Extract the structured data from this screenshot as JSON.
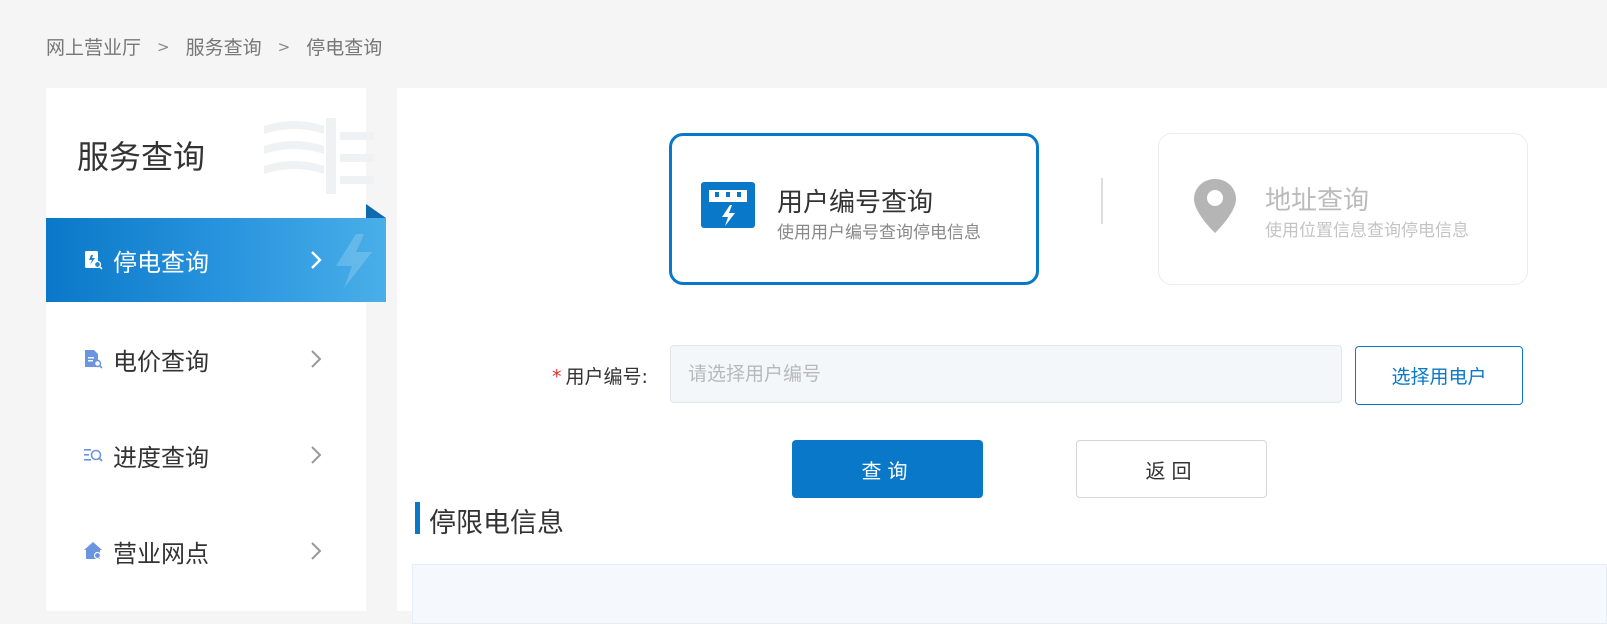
{
  "breadcrumb": {
    "items": [
      "网上营业厅",
      "服务查询",
      "停电查询"
    ],
    "separator": ">"
  },
  "sidebar": {
    "title": "服务查询",
    "items": [
      {
        "label": "停电查询",
        "icon": "outage-search-icon",
        "active": true
      },
      {
        "label": "电价查询",
        "icon": "price-search-icon",
        "active": false
      },
      {
        "label": "进度查询",
        "icon": "progress-search-icon",
        "active": false
      },
      {
        "label": "营业网点",
        "icon": "service-outlet-icon",
        "active": false
      }
    ]
  },
  "query_modes": [
    {
      "title": "用户编号查询",
      "subtitle": "使用用户编号查询停电信息",
      "icon": "meter-icon",
      "active": true
    },
    {
      "title": "地址查询",
      "subtitle": "使用位置信息查询停电信息",
      "icon": "location-pin-icon",
      "active": false
    }
  ],
  "form": {
    "required_mark": "*",
    "label": "用户编号:",
    "placeholder": "请选择用户编号",
    "value": "",
    "select_button": "选择用电户"
  },
  "actions": {
    "query": "查询",
    "back": "返回"
  },
  "section": {
    "title": "停限电信息"
  },
  "colors": {
    "primary": "#0a78c8",
    "required": "#e0302b",
    "background": "#f5f5f5"
  }
}
